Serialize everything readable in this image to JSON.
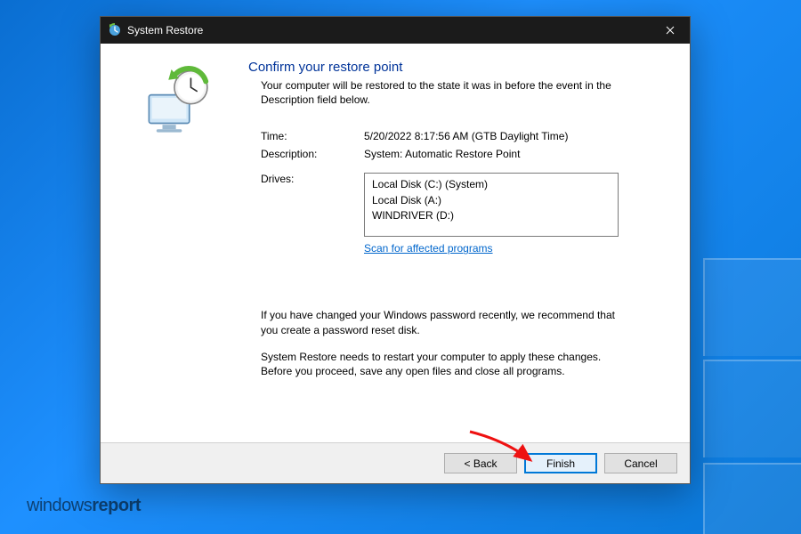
{
  "desktop": {
    "watermark_prefix": "windows",
    "watermark_bold": "report"
  },
  "dialog": {
    "title": "System Restore",
    "heading": "Confirm your restore point",
    "subtext": "Your computer will be restored to the state it was in before the event in the Description field below.",
    "fields": {
      "time_label": "Time:",
      "time_value": "5/20/2022 8:17:56 AM (GTB Daylight Time)",
      "description_label": "Description:",
      "description_value": "System: Automatic Restore Point",
      "drives_label": "Drives:",
      "drives": [
        "Local Disk (C:) (System)",
        "Local Disk (A:)",
        "WINDRIVER (D:)"
      ],
      "scan_link": "Scan for affected programs"
    },
    "notes": {
      "p1": "If you have changed your Windows password recently, we recommend that you create a password reset disk.",
      "p2": "System Restore needs to restart your computer to apply these changes. Before you proceed, save any open files and close all programs."
    },
    "buttons": {
      "back": "< Back",
      "finish": "Finish",
      "cancel": "Cancel"
    }
  }
}
